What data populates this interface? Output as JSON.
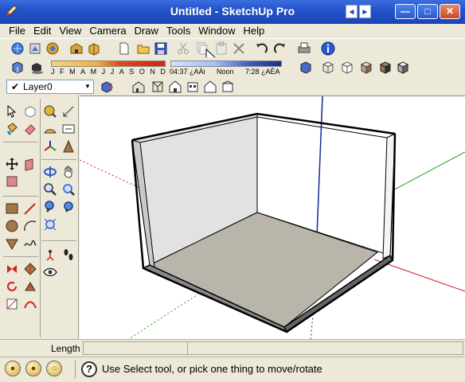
{
  "window": {
    "title": "Untitled - SketchUp Pro",
    "app_icon": "sketchup-pencil-icon",
    "controls": {
      "minimize": "—",
      "maximize": "□",
      "close": "✕"
    },
    "tab_scroll": {
      "left": "◄",
      "right": "►"
    }
  },
  "menu": {
    "items": [
      "File",
      "Edit",
      "View",
      "Camera",
      "Draw",
      "Tools",
      "Window",
      "Help"
    ]
  },
  "toolbar_standard": {
    "icons": [
      "new-icon",
      "open-icon",
      "save-icon",
      "cut-icon",
      "copy-icon",
      "paste-icon",
      "erase-icon",
      "undo-icon",
      "redo-icon",
      "print-icon",
      "model-info-icon"
    ]
  },
  "shadows": {
    "months": [
      "J",
      "F",
      "M",
      "A",
      "M",
      "J",
      "J",
      "A",
      "S",
      "O",
      "N",
      "D"
    ],
    "time_start": "04:37 ¿AÀi",
    "time_noon": "Noon",
    "time_end": "7:28 ¿AÈA"
  },
  "layers": {
    "current": "Layer0",
    "check": "✔",
    "dropdown": "▼"
  },
  "vcb": {
    "label": "Length",
    "value": ""
  },
  "status": {
    "message": "Use Select tool, or pick one thing to move/rotate",
    "help_glyph": "?",
    "icons": [
      "geo-location-icon",
      "credits-icon",
      "signature-icon"
    ]
  },
  "colors": {
    "title_bar": "#2353c9",
    "chrome": "#ece9d8",
    "axis_red": "#cc2222",
    "axis_green": "#22aa22",
    "axis_blue": "#1a2a9a",
    "wall": "#e2e2e2",
    "floor": "#b9b5aa"
  }
}
